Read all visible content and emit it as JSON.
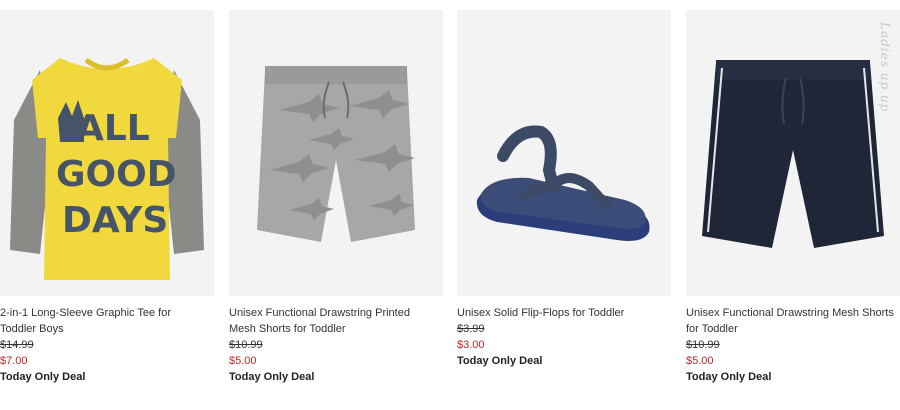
{
  "colors": {
    "sale_price": "#c1272d",
    "image_bg": "#f3f3f3"
  },
  "products": [
    {
      "title": "2-in-1 Long-Sleeve Graphic Tee for Toddler Boys",
      "was_price": "$14.99",
      "sale_price": "$7.00",
      "deal": "Today Only Deal",
      "graphic_text": [
        "ALL",
        "GOOD",
        "DAYS"
      ],
      "image_icon": "yellow-tee-image"
    },
    {
      "title": "Unisex Functional Drawstring Printed Mesh Shorts for Toddler",
      "was_price": "$10.99",
      "sale_price": "$5.00",
      "deal": "Today Only Deal",
      "image_icon": "gray-shark-shorts-image"
    },
    {
      "title": "Unisex Solid Flip-Flops for Toddler",
      "was_price": "$3.99",
      "sale_price": "$3.00",
      "deal": "Today Only Deal",
      "image_icon": "navy-flip-flop-image"
    },
    {
      "title": "Unisex Functional Drawstring Mesh Shorts for Toddler",
      "was_price": "$10.99",
      "sale_price": "$5.00",
      "deal": "Today Only Deal",
      "image_icon": "navy-mesh-shorts-image"
    }
  ],
  "watermark": "Ladies up up"
}
